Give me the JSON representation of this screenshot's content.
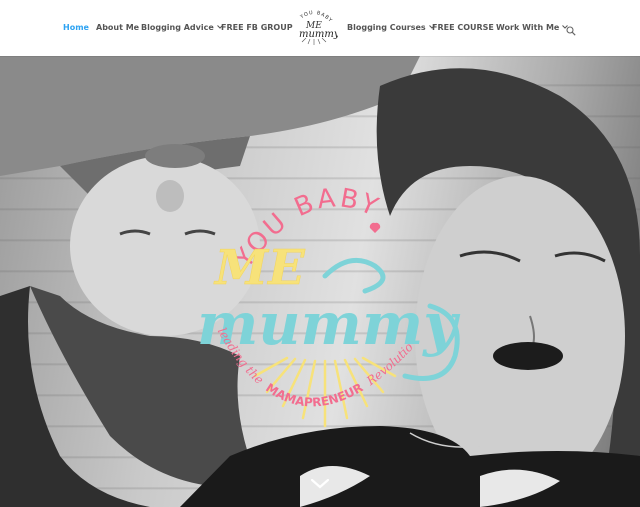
{
  "nav": {
    "left_items": [
      {
        "label": "Home",
        "active": true,
        "has_dropdown": false
      },
      {
        "label": "About Me",
        "active": false,
        "has_dropdown": false
      },
      {
        "label": "Blogging Advice",
        "active": false,
        "has_dropdown": true
      },
      {
        "label": "FREE FB GROUP",
        "active": false,
        "has_dropdown": false
      }
    ],
    "right_items": [
      {
        "label": "Blogging Courses",
        "active": false,
        "has_dropdown": true
      },
      {
        "label": "FREE COURSE",
        "active": false,
        "has_dropdown": false
      },
      {
        "label": "Work With Me",
        "active": false,
        "has_dropdown": true
      }
    ],
    "search_icon": "search-icon",
    "brand": {
      "line1": "YOU BABY",
      "line2": "ME",
      "line3": "mummy"
    }
  },
  "hero": {
    "logo": {
      "top_text": "YOU BABY",
      "middle_text": "ME",
      "main_text": "mummy",
      "tagline_prefix": "leading the",
      "tagline_highlight": "MAMAPRENEUR",
      "tagline_suffix": "Revolution"
    },
    "scroll_icon": "chevron-down-icon"
  },
  "colors": {
    "active_link": "#2ea3f2",
    "nav_text": "#555555",
    "logo_pink": "#f26d8f",
    "logo_yellow": "#f7e27a",
    "logo_teal": "#7ed3d8"
  }
}
